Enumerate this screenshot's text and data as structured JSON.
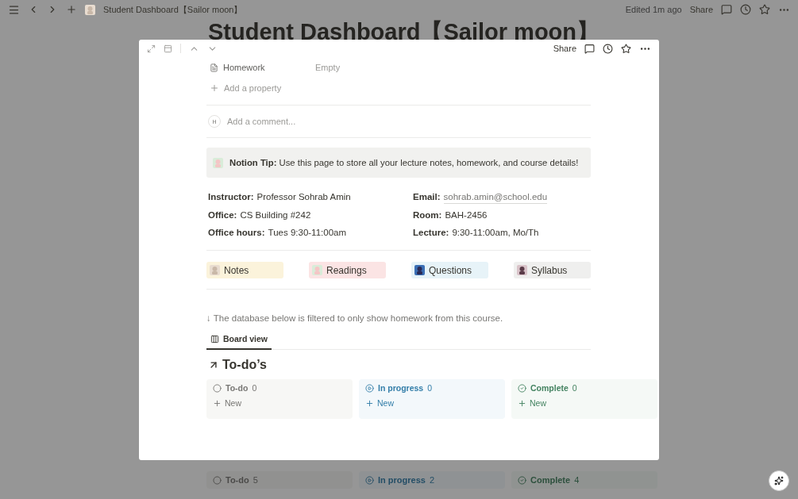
{
  "topbar": {
    "title": "Student Dashboard【Sailor moon】",
    "edited": "Edited 1m ago",
    "share": "Share"
  },
  "page_title": "Student Dashboard【Sailor moon】",
  "background_board": [
    {
      "kind": "todo",
      "label": "To-do",
      "count": "5"
    },
    {
      "kind": "progress",
      "label": "In progress",
      "count": "2"
    },
    {
      "kind": "complete",
      "label": "Complete",
      "count": "4"
    }
  ],
  "modal": {
    "share": "Share",
    "property": {
      "label": "Homework",
      "value": "Empty"
    },
    "add_property": "Add a property",
    "comment": {
      "avatar": "H",
      "placeholder": "Add a comment..."
    },
    "tip": "**Notion Tip:** Use this page to store all your lecture notes, homework, and course details!",
    "info": [
      {
        "label": "Instructor:",
        "value": "Professor Sohrab Amin",
        "kind": "text"
      },
      {
        "label": "Email:",
        "value": "sohrab.amin@school.edu",
        "kind": "link"
      },
      {
        "label": "Office:",
        "value": "CS Building #242",
        "kind": "text"
      },
      {
        "label": "Room:",
        "value": "BAH-2456",
        "kind": "text"
      },
      {
        "label": "Office hours:",
        "value": "Tues 9:30-11:00am",
        "kind": "text"
      },
      {
        "label": "Lecture:",
        "value": "9:30-11:00am, Mo/Th",
        "kind": "text"
      }
    ],
    "links": [
      {
        "label": "Notes",
        "color": "#fbf3db"
      },
      {
        "label": "Readings",
        "color": "#fbe4e4"
      },
      {
        "label": "Questions",
        "color": "#e7f3f8"
      },
      {
        "label": "Syllabus",
        "color": "#efefee"
      }
    ],
    "filter_note": "↓ The database below is filtered to only show homework from this course.",
    "views": [
      {
        "label": "Board view",
        "selected": true
      }
    ],
    "board_title": "To-do’s",
    "board": [
      {
        "kind": "todo",
        "label": "To-do",
        "count": "0",
        "new": "New"
      },
      {
        "kind": "progress",
        "label": "In progress",
        "count": "0",
        "new": "New"
      },
      {
        "kind": "complete",
        "label": "Complete",
        "count": "0",
        "new": "New"
      }
    ]
  }
}
